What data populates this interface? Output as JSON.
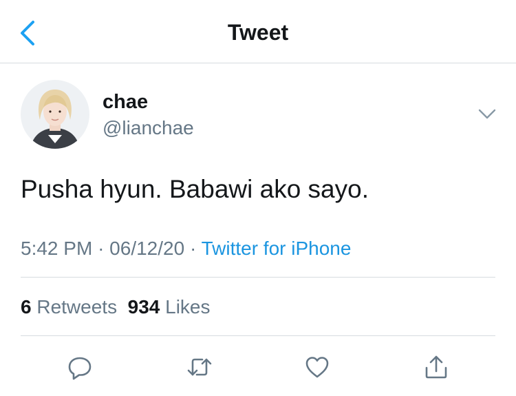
{
  "header": {
    "title": "Tweet"
  },
  "tweet": {
    "author": {
      "name": "chae",
      "handle": "@lianchae"
    },
    "text": "Pusha hyun. Babawi ako sayo.",
    "time": "5:42 PM",
    "date": "06/12/20",
    "separator": "·",
    "source": "Twitter for iPhone"
  },
  "stats": {
    "retweets_count": "6",
    "retweets_label": "Retweets",
    "likes_count": "934",
    "likes_label": "Likes"
  },
  "colors": {
    "accent": "#1da1f2",
    "secondary_text": "#657786",
    "divider": "#d6dbdf",
    "icon": "#657786"
  }
}
